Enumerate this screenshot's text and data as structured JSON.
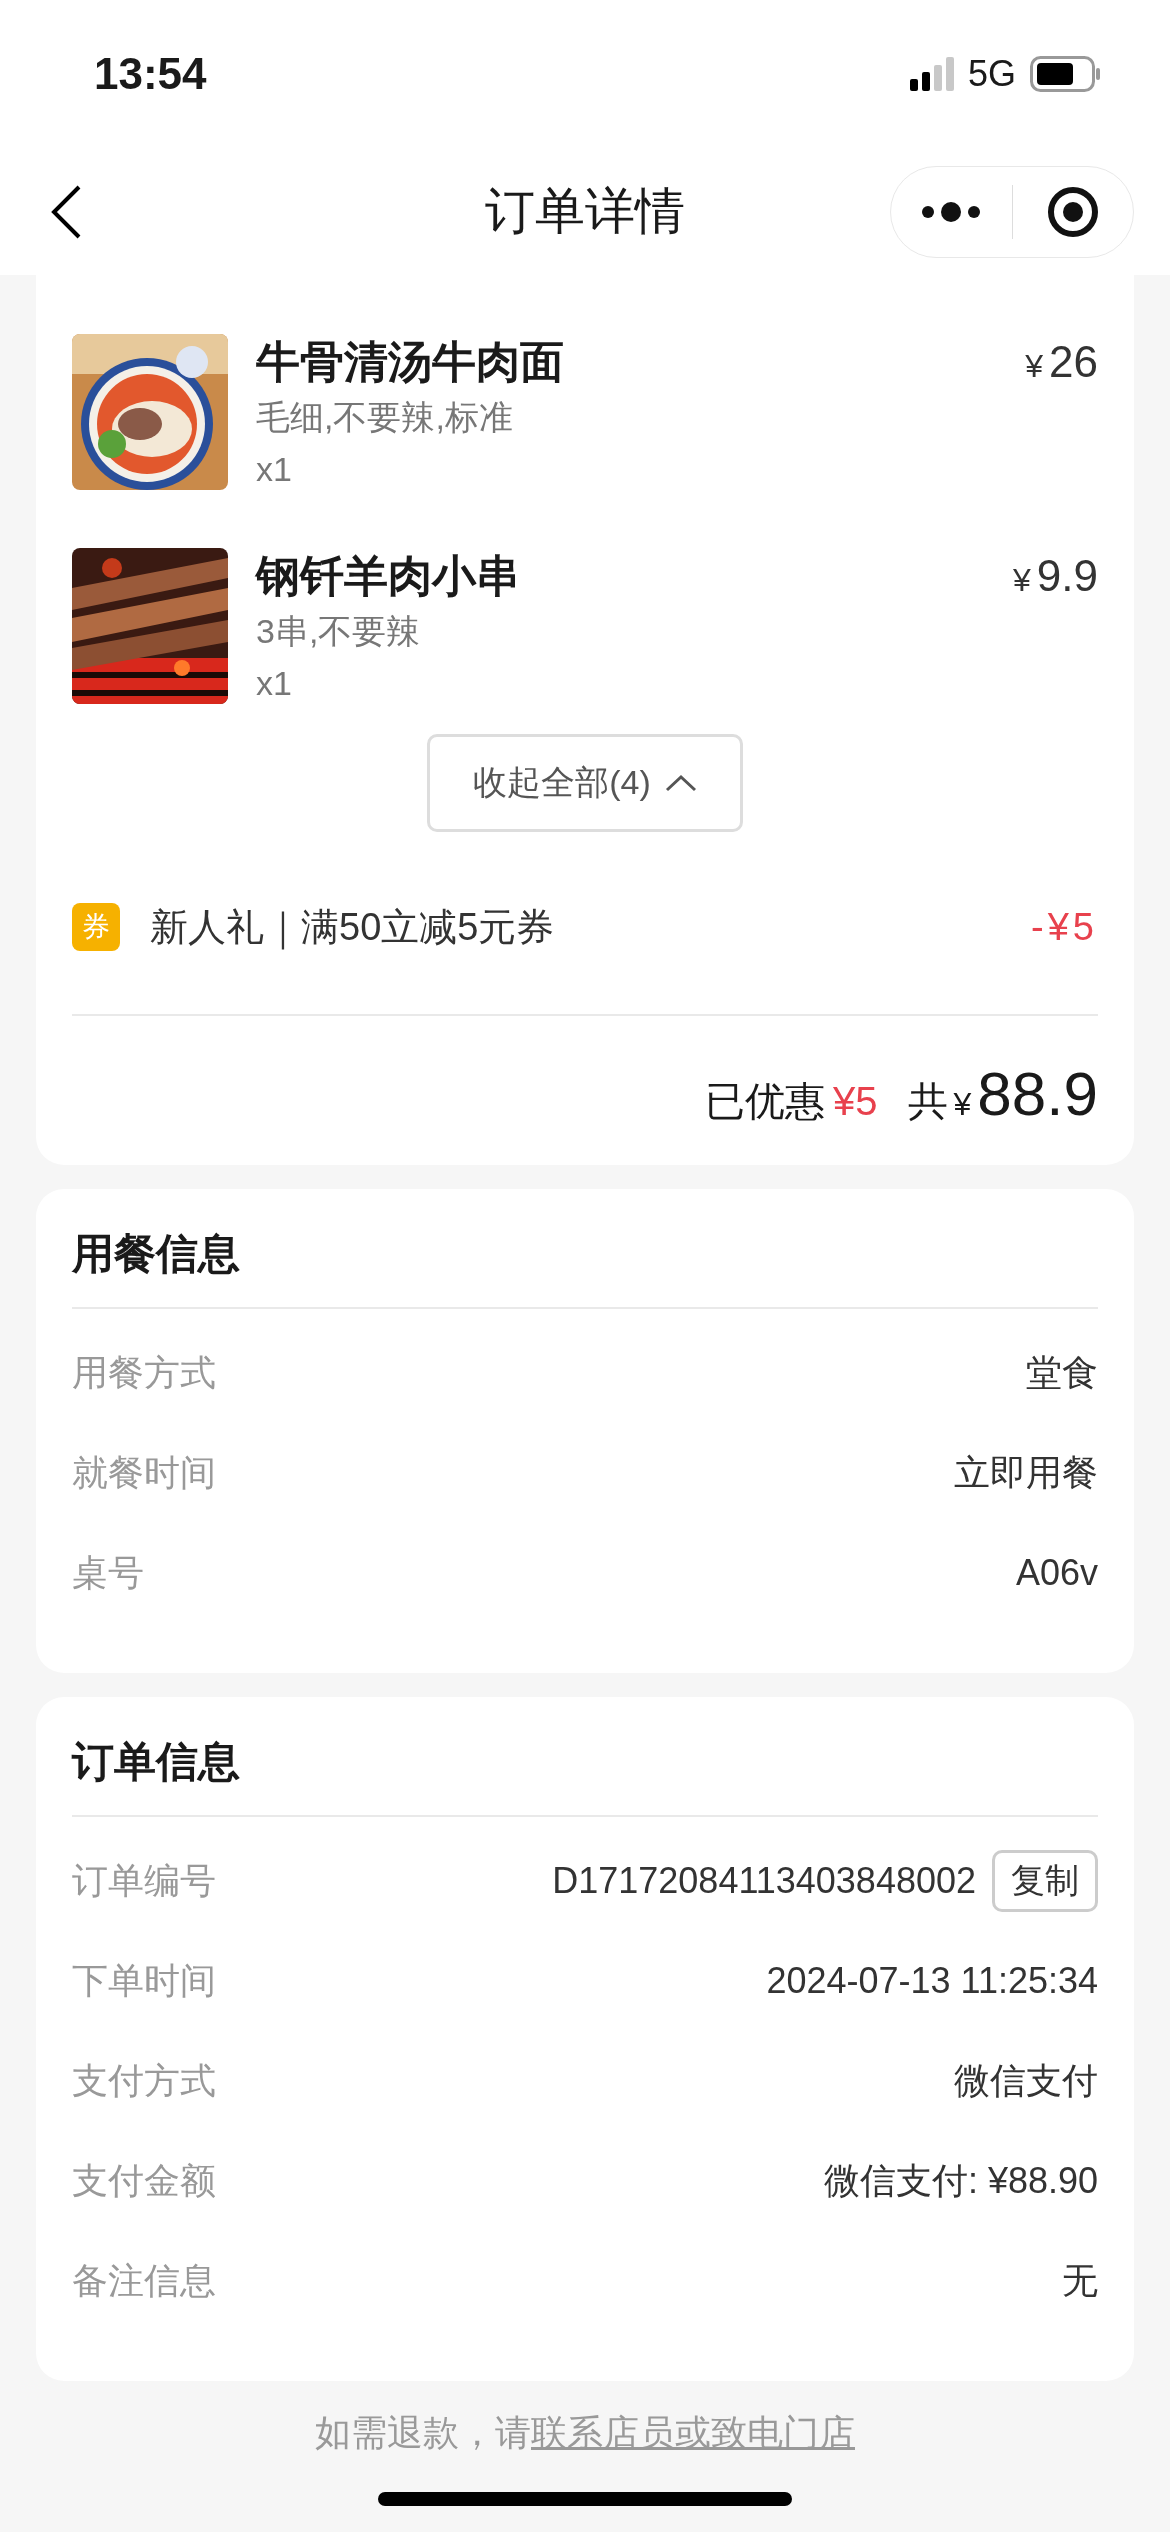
{
  "status_bar": {
    "time": "13:54",
    "network": "5G"
  },
  "nav": {
    "title": "订单详情"
  },
  "items": [
    {
      "kind": "noodles",
      "name": "牛骨清汤牛肉面",
      "options": "毛细,不要辣,标准",
      "quantity": "x1",
      "currency": "¥",
      "price": "26"
    },
    {
      "kind": "skewers",
      "name": "钢钎羊肉小串",
      "options": "3串,不要辣",
      "quantity": "x1",
      "currency": "¥",
      "price": "9.9"
    }
  ],
  "collapse_button": {
    "label": "收起全部(4)"
  },
  "coupon": {
    "badge": "券",
    "text": "新人礼｜满50立减5元券",
    "amount": "-¥5"
  },
  "summary": {
    "discount_label": "已优惠",
    "discount": "¥5",
    "total_label": "共",
    "currency": "¥",
    "total": "88.9"
  },
  "sections": [
    {
      "title": "用餐信息",
      "rows": [
        {
          "label": "用餐方式",
          "value": "堂食"
        },
        {
          "label": "就餐时间",
          "value": "立即用餐"
        },
        {
          "label": "桌号",
          "value": "A06v"
        }
      ]
    },
    {
      "title": "订单信息",
      "rows": [
        {
          "label": "订单编号",
          "value": "D17172084113403848002",
          "action": "复制"
        },
        {
          "label": "下单时间",
          "value": "2024-07-13 11:25:34"
        },
        {
          "label": "支付方式",
          "value": "微信支付"
        },
        {
          "label": "支付金额",
          "value": "微信支付: ¥88.90"
        },
        {
          "label": "备注信息",
          "value": "无"
        }
      ]
    }
  ],
  "footer": {
    "text": "如需退款，请",
    "link": "联系店员或致电门店"
  }
}
